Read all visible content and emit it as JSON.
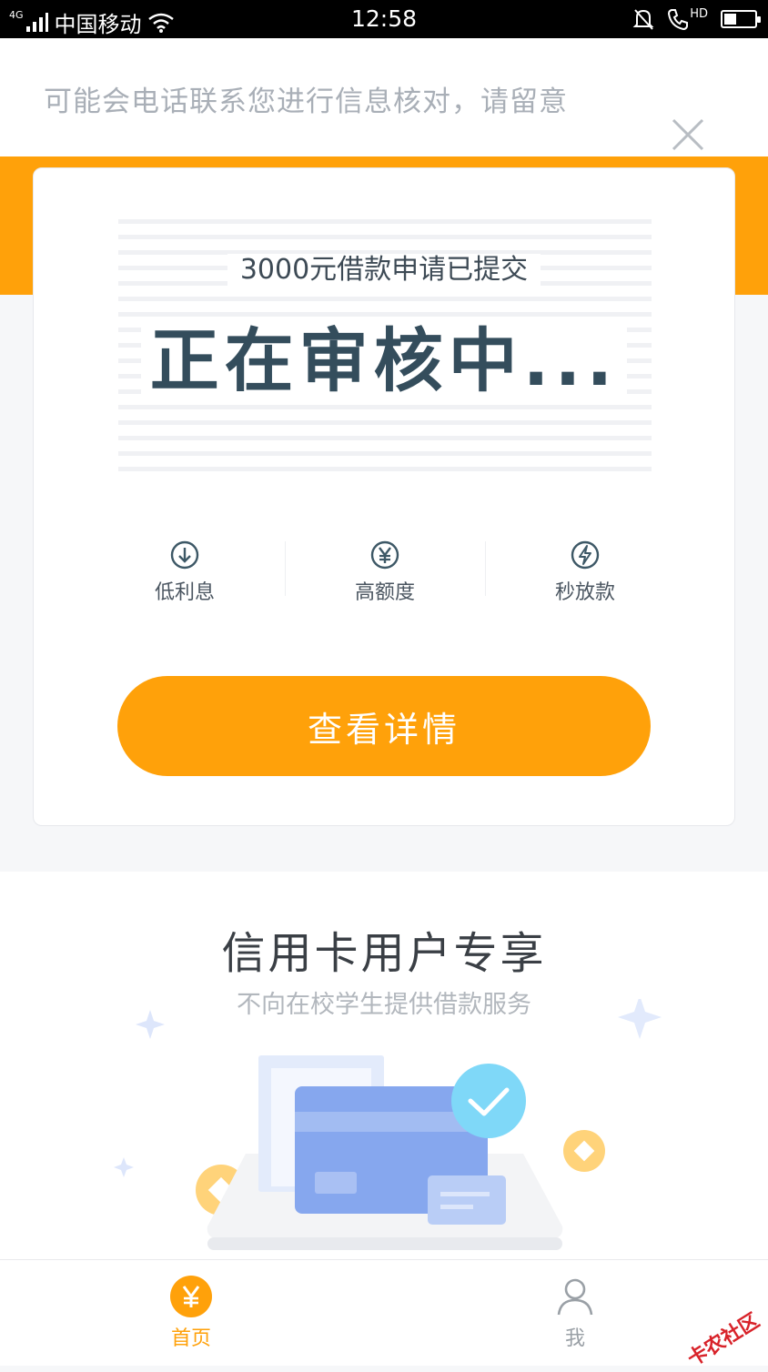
{
  "status_bar": {
    "network": "4G",
    "carrier": "中国移动",
    "time": "12:58",
    "volte": "HD",
    "battery_level": 0.4
  },
  "notice": {
    "text": "可能会电话联系您进行信息核对，请留意"
  },
  "card": {
    "submitted_text": "3000元借款申请已提交",
    "status_text": "正在审核中...",
    "features": [
      {
        "label": "低利息",
        "icon": "download-circle-icon"
      },
      {
        "label": "高额度",
        "icon": "yuan-circle-icon"
      },
      {
        "label": "秒放款",
        "icon": "lightning-circle-icon"
      }
    ],
    "detail_button": "查看详情"
  },
  "promo": {
    "title": "信用卡用户专享",
    "subtitle": "不向在校学生提供借款服务"
  },
  "tab_bar": {
    "home_label": "首页",
    "me_label": "我"
  },
  "watermark": "卡农社区",
  "colors": {
    "accent": "#ffa10a",
    "status_text": "#344d5c"
  }
}
